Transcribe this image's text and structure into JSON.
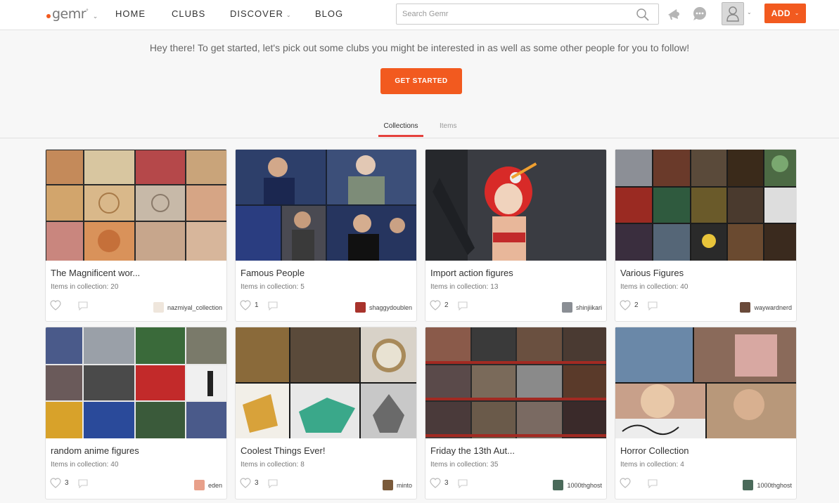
{
  "header": {
    "logo": "gemr",
    "logo_mark": "°",
    "nav": [
      {
        "label": "HOME"
      },
      {
        "label": "CLUBS"
      },
      {
        "label": "DISCOVER"
      },
      {
        "label": "BLOG"
      }
    ],
    "search_placeholder": "Search Gemr",
    "add_label": "ADD"
  },
  "intro": {
    "message": "Hey there! To get started, let's pick out some clubs you might be interested in as well as some other people for you to follow!",
    "cta_label": "GET STARTED"
  },
  "tabs": [
    {
      "label": "Collections",
      "active": true
    },
    {
      "label": "Items",
      "active": false
    }
  ],
  "colors": {
    "accent": "#f25a1f",
    "tab_underline": "#e4413c"
  },
  "count_label": "Items in collection:",
  "cards": [
    {
      "title": "The Magnificent wor...",
      "count": "20",
      "likes": "",
      "owner": "nazmiyal_collection"
    },
    {
      "title": "Famous People",
      "count": "5",
      "likes": "1",
      "owner": "shaggydoublen"
    },
    {
      "title": "Import action figures",
      "count": "13",
      "likes": "2",
      "owner": "shinjiikari"
    },
    {
      "title": "Various Figures",
      "count": "40",
      "likes": "2",
      "owner": "waywardnerd"
    },
    {
      "title": "random anime figures",
      "count": "40",
      "likes": "3",
      "owner": "eden"
    },
    {
      "title": "Coolest Things Ever!",
      "count": "8",
      "likes": "3",
      "owner": "minto"
    },
    {
      "title": "Friday the 13th Aut...",
      "count": "35",
      "likes": "3",
      "owner": "1000thghost"
    },
    {
      "title": "Horror Collection",
      "count": "4",
      "likes": "",
      "owner": "1000thghost"
    }
  ]
}
